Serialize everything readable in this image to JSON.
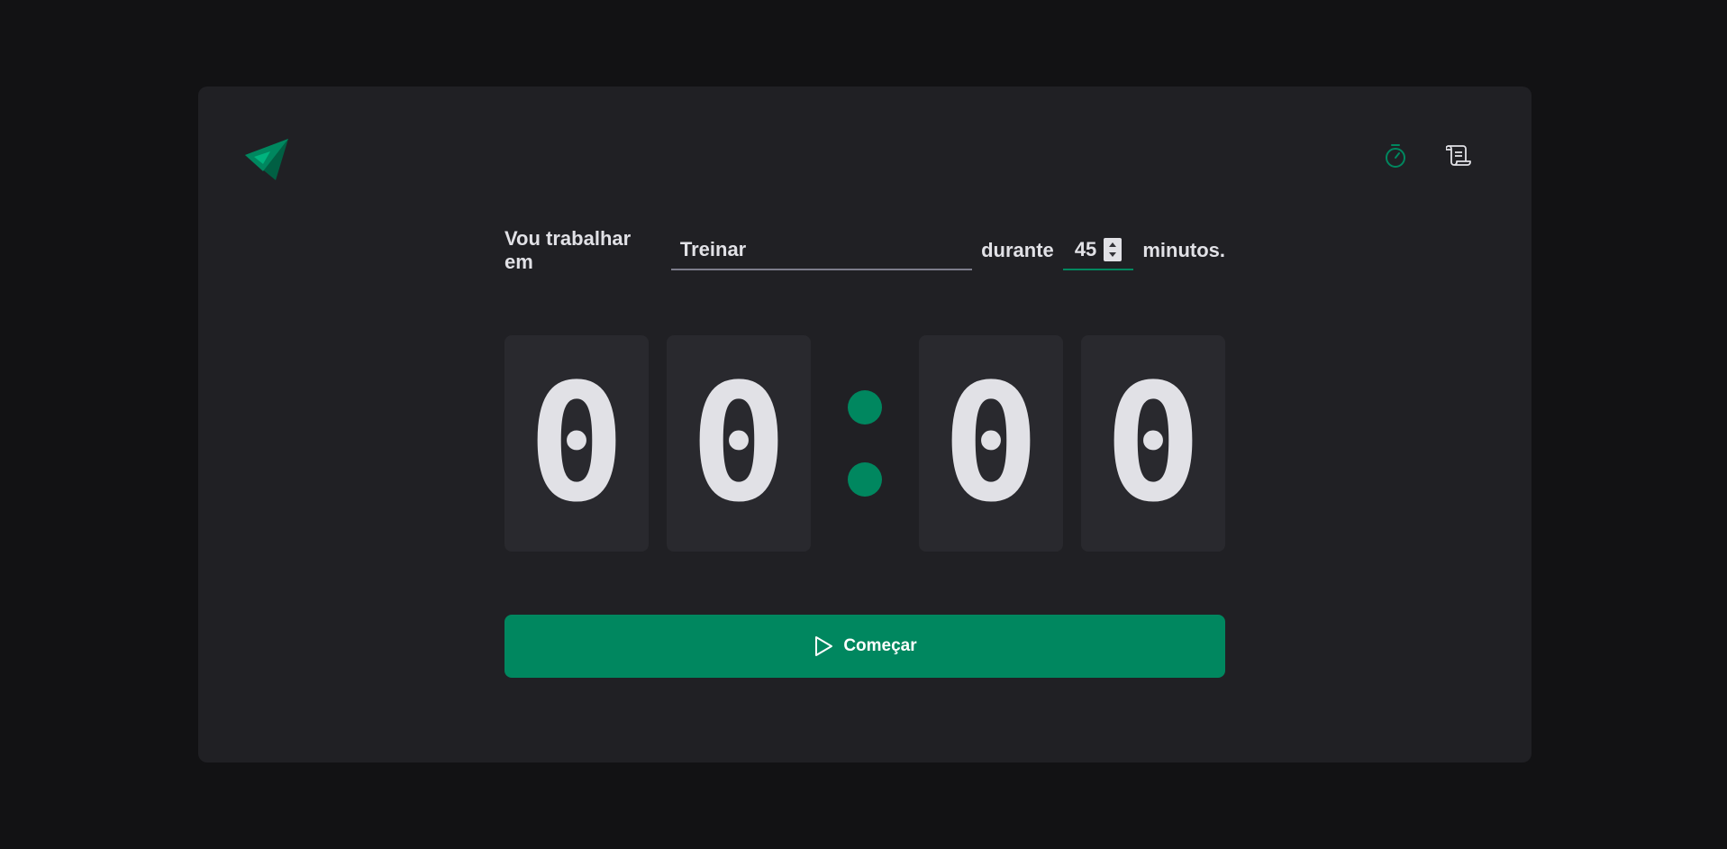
{
  "header": {
    "logo_icon": "ignite-logo-icon",
    "nav": [
      {
        "icon": "timer-icon",
        "active": true
      },
      {
        "icon": "history-scroll-icon",
        "active": false
      }
    ]
  },
  "form": {
    "task_label": "Vou trabalhar em",
    "task_value": "Treinar",
    "duration_label": "durante",
    "minutes_value": "45",
    "minutes_suffix": "minutos."
  },
  "countdown": {
    "digits": [
      "0",
      "0",
      "0",
      "0"
    ],
    "separator": ":"
  },
  "start_button": {
    "label": "Começar",
    "icon": "play-icon"
  },
  "colors": {
    "background": "#121214",
    "card": "#202024",
    "accent": "#00875f",
    "digit_bg": "#29292e",
    "text": "#e1e1e6"
  }
}
